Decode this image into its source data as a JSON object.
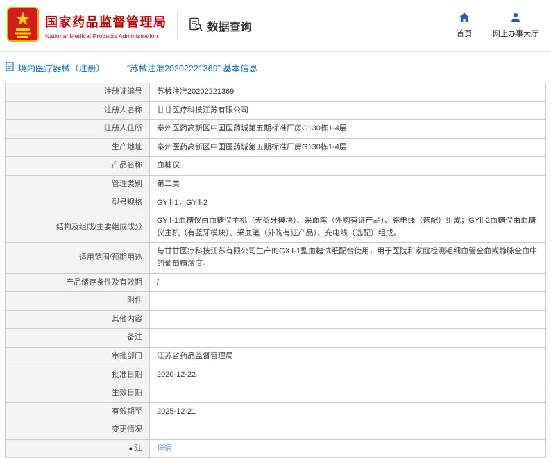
{
  "header": {
    "agency_cn": "国家药品监督管理局",
    "agency_en": "National Medical Products Administration",
    "section_title": "数据查询",
    "nav_home": "首页",
    "nav_hall": "网上办事大厅"
  },
  "breadcrumb": {
    "text": "境内医疗器械（注册） —— “苏械注准20202221369” 基本信息"
  },
  "colors": {
    "brand_red": "#c40000",
    "nav_icon_blue": "#2a5caa",
    "breadcrumb_blue": "#1a73b9",
    "link_blue": "#4f9bd8",
    "label_cell_bg": "#f4f4f4",
    "table_border": "#cccccc"
  },
  "table": {
    "rows": [
      {
        "label": "注册证编号",
        "value": "苏械注准20202221369"
      },
      {
        "label": "注册人名称",
        "value": "甘甘医疗科技江苏有限公司"
      },
      {
        "label": "注册人住所",
        "value": "泰州医药高新区中国医药城第五期标准厂房G130栋1-4层"
      },
      {
        "label": "生产地址",
        "value": "泰州医药高新区中国医药城第五期标准厂房G130栋1-4层"
      },
      {
        "label": "产品名称",
        "value": "血糖仪"
      },
      {
        "label": "管理类别",
        "value": "第二类"
      },
      {
        "label": "型号规格",
        "value": "GYⅡ-1，GYⅡ-2"
      },
      {
        "label": "结构及组成/主要组成成分",
        "value": "GYⅡ-1血糖仪由血糖仪主机（无蓝牙模块）、采血笔（外购有证产品）、充电线（选配）组成；GYⅡ-2血糖仪由血糖仪主机（有蓝牙模块）、采血笔（外购有证产品）、充电线（选配）组成。"
      },
      {
        "label": "适用范围/预期用途",
        "value": "与甘甘医疗科技江苏有限公司生产的GXⅡ-1型血糖试纸配合使用，用于医院和家庭检测毛细血管全血或静脉全血中的葡萄糖浓度。"
      },
      {
        "label": "产品储存条件及有效期",
        "value": "/"
      },
      {
        "label": "附件",
        "value": ""
      },
      {
        "label": "其他内容",
        "value": ""
      },
      {
        "label": "备注",
        "value": ""
      },
      {
        "label": "审批部门",
        "value": "江苏省药品监督管理局"
      },
      {
        "label": "批准日期",
        "value": "2020-12-22"
      },
      {
        "label": "生效日期",
        "value": ""
      },
      {
        "label": "有效期至",
        "value": "2025-12-21"
      },
      {
        "label": "变更情况",
        "value": ""
      },
      {
        "label": "注",
        "bullet": "●",
        "value": "详情"
      }
    ]
  }
}
